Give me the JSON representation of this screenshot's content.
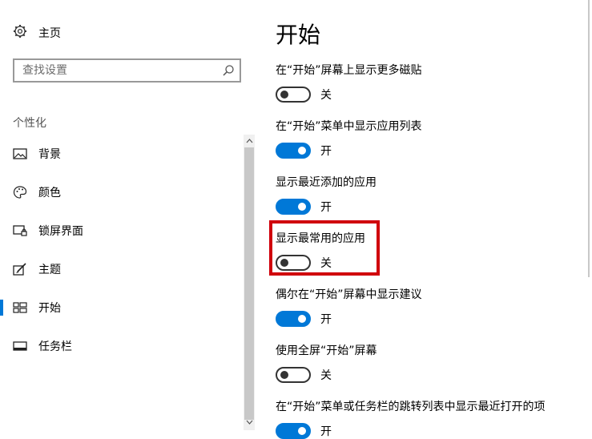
{
  "sidebar": {
    "home_label": "主页",
    "search_placeholder": "查找设置",
    "section_label": "个性化",
    "items": [
      {
        "label": "背景",
        "icon": "image-icon",
        "active": false
      },
      {
        "label": "颜色",
        "icon": "palette-icon",
        "active": false
      },
      {
        "label": "锁屏界面",
        "icon": "lock-screen-icon",
        "active": false
      },
      {
        "label": "主题",
        "icon": "theme-brush-icon",
        "active": false
      },
      {
        "label": "开始",
        "icon": "start-grid-icon",
        "active": true
      },
      {
        "label": "任务栏",
        "icon": "taskbar-icon",
        "active": false
      }
    ]
  },
  "main": {
    "title": "开始",
    "settings": [
      {
        "label": "在“开始”屏幕上显示更多磁贴",
        "on": false,
        "state": "关"
      },
      {
        "label": "在“开始”菜单中显示应用列表",
        "on": true,
        "state": "开"
      },
      {
        "label": "显示最近添加的应用",
        "on": true,
        "state": "开"
      },
      {
        "label": "显示最常用的应用",
        "on": false,
        "state": "关"
      },
      {
        "label": "偶尔在“开始”屏幕中显示建议",
        "on": true,
        "state": "开"
      },
      {
        "label": "使用全屏“开始”屏幕",
        "on": false,
        "state": "关"
      },
      {
        "label": "在“开始”菜单或任务栏的跳转列表中显示最近打开的项",
        "on": true,
        "state": "开"
      }
    ]
  },
  "colors": {
    "accent": "#0078d7",
    "highlight_border": "#d0000c"
  }
}
